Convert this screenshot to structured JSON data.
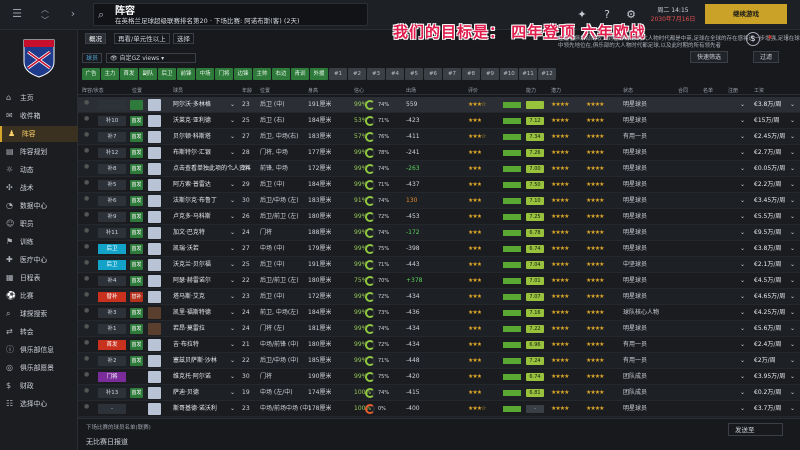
{
  "top": {
    "title": "阵容",
    "subtitle": "在英格兰足球超级联赛排名第20 · 下场比赛: 阿诺布斯(客) (2天)",
    "clock_time": "周二 14:15",
    "clock_date": "2030年7月16日",
    "continue_label": "继续游戏",
    "nav_back": "‹",
    "nav_forward": "›"
  },
  "sidebar": {
    "items": [
      {
        "label": "主页",
        "icon": "home-icon",
        "glyph": "⌂"
      },
      {
        "label": "收件箱",
        "icon": "inbox-icon",
        "glyph": "✉"
      },
      {
        "label": "阵容",
        "icon": "squad-icon",
        "glyph": "♟",
        "active": true
      },
      {
        "label": "阵容规划",
        "icon": "plan-icon",
        "glyph": "▤"
      },
      {
        "label": "动态",
        "icon": "dynamics-icon",
        "glyph": "☼"
      },
      {
        "label": "战术",
        "icon": "tactics-icon",
        "glyph": "✣"
      },
      {
        "label": "数据中心",
        "icon": "data-icon",
        "glyph": "◔"
      },
      {
        "label": "职员",
        "icon": "staff-icon",
        "glyph": "☺"
      },
      {
        "label": "训练",
        "icon": "training-icon",
        "glyph": "⚑"
      },
      {
        "label": "医疗中心",
        "icon": "medical-icon",
        "glyph": "✚"
      },
      {
        "label": "日程表",
        "icon": "calendar-icon",
        "glyph": "▦"
      },
      {
        "label": "比赛",
        "icon": "match-icon",
        "glyph": "⚽"
      },
      {
        "label": "球探搜索",
        "icon": "scout-icon",
        "glyph": "⌕"
      },
      {
        "label": "转会",
        "icon": "transfer-icon",
        "glyph": "⇄"
      },
      {
        "label": "俱乐部信息",
        "icon": "club-info-icon",
        "glyph": "ⓘ"
      },
      {
        "label": "俱乐部愿景",
        "icon": "vision-icon",
        "glyph": "◎"
      },
      {
        "label": "财政",
        "icon": "finance-icon",
        "glyph": "$"
      },
      {
        "label": "选择中心",
        "icon": "dev-icon",
        "glyph": "☷"
      }
    ]
  },
  "tabs": [
    "概况",
    "再看/单元性以上",
    "选择"
  ],
  "slogan": "我们的目标是： 四年登顶 六年欧战",
  "overlay_text": "在这位俱乐部的收入到位,俱乐部的大人物时代都是中英,足球在全球的存在感将进一步增强,足球在球员之中领先地位在,俱乐部的大人物时代都足球,以及此时期的所有领先者",
  "view": {
    "label": "自定GZ views",
    "filter_label": "球员"
  },
  "right_dropdowns": [
    "快速筛选",
    "过滤"
  ],
  "chips": [
    "广告",
    "主力",
    "首发",
    "副队",
    "后卫",
    "前锋",
    "中场",
    "门将",
    "边锋",
    "主帅",
    "右边",
    "青训",
    "外援",
    "#1",
    "#2",
    "#3",
    "#4",
    "#5",
    "#6",
    "#7",
    "#8",
    "#9",
    "#10",
    "#11",
    "#12"
  ],
  "headers": [
    "阵容/状态",
    "位置",
    "球员",
    "年龄",
    "位置",
    "身高",
    "体重",
    "信心",
    "出场",
    "评价",
    "能力",
    "潜力",
    "状态",
    "合同",
    "名单",
    "注册",
    "时间",
    "工资"
  ],
  "players": [
    {
      "status": "",
      "role": "",
      "name": "阿尔沃·多林格",
      "age": "23",
      "pos": "后卫 (中)",
      "height": "191厘米",
      "pct": "99%",
      "ring": "74%",
      "cash": "559",
      "cashc": "",
      "stars": "★★★☆",
      "ab": "",
      "stars2": "★★★★",
      "stars3": "★★★★",
      "tag": "明星球员",
      "wage": "€3.8万/周",
      "face": "l",
      "hl": true
    },
    {
      "status": "补10",
      "role": "首发",
      "rolec": "g",
      "name": "沃莱克·亚利德",
      "age": "25",
      "pos": "后卫 (右)",
      "height": "184厘米",
      "pct": "53%",
      "ring": "71%",
      "cash": "-423",
      "cashc": "",
      "stars": "★★★",
      "ab": "7.12",
      "stars2": "★★★★",
      "stars3": "★★★★",
      "tag": "明星球员",
      "wage": "€15万/周",
      "face": "l"
    },
    {
      "status": "补7",
      "role": "首发",
      "rolec": "g",
      "name": "贝尔顿·科斯塔",
      "age": "27",
      "pos": "后卫, 中场(右)",
      "height": "183厘米",
      "pct": "57%",
      "ring": "76%",
      "cash": "-411",
      "cashc": "",
      "stars": "★★★☆",
      "ab": "7.34",
      "stars2": "★★★★",
      "stars3": "★★★★",
      "tag": "有用一员",
      "wage": "€2.45万/周",
      "face": "l"
    },
    {
      "status": "补12",
      "role": "首发",
      "rolec": "g",
      "name": "布斯特尔·汇银",
      "age": "28",
      "pos": "门将, 中场",
      "height": "177厘米",
      "pct": "99%",
      "ring": "78%",
      "cash": "-241",
      "cashc": "",
      "stars": "★★★",
      "ab": "7.26",
      "stars2": "★★★★",
      "stars3": "★★★★",
      "tag": "明星球员",
      "wage": "€2.7万/周",
      "face": "l"
    },
    {
      "status": "补8",
      "role": "首发",
      "rolec": "g",
      "name": "点击查看单独此项的个人资料",
      "age": "24",
      "pos": "前锋, 中场",
      "height": "172厘米",
      "pct": "99%",
      "ring": "74%",
      "cash": "-263",
      "cashc": "green",
      "stars": "★★★",
      "ab": "7.00",
      "stars2": "★★★★",
      "stars3": "★★★★",
      "tag": "明星球员",
      "wage": "€0.05万/周",
      "face": "l"
    },
    {
      "status": "补5",
      "role": "首发",
      "rolec": "g",
      "name": "阿方索·普雷达",
      "age": "29",
      "pos": "后卫 (中)",
      "height": "184厘米",
      "pct": "99%",
      "ring": "71%",
      "cash": "-437",
      "cashc": "",
      "stars": "★★★",
      "ab": "7.50",
      "stars2": "★★★★",
      "stars3": "★★★★",
      "tag": "明星球员",
      "wage": "€2.2万/周",
      "face": "l"
    },
    {
      "status": "补6",
      "role": "首发",
      "rolec": "g",
      "name": "法斯尔克·布鲁丁",
      "age": "30",
      "pos": "后卫/中场 (左)",
      "height": "183厘米",
      "pct": "91%",
      "ring": "74%",
      "cash": "130",
      "cashc": "orange",
      "stars": "★★★",
      "ab": "7.10",
      "stars2": "★★★★",
      "stars3": "★★★★",
      "tag": "明星球员",
      "wage": "€3.45万/周",
      "face": "l"
    },
    {
      "status": "补9",
      "role": "首发",
      "rolec": "g",
      "name": "卢克多·马科斯",
      "age": "26",
      "pos": "后卫/前卫 (左)",
      "height": "180厘米",
      "pct": "99%",
      "ring": "72%",
      "cash": "-453",
      "cashc": "",
      "stars": "★★★",
      "ab": "7.25",
      "stars2": "★★★★",
      "stars3": "★★★★",
      "tag": "明星球员",
      "wage": "€5.5万/周",
      "face": "l"
    },
    {
      "status": "补11",
      "role": "首发",
      "rolec": "g",
      "name": "加文·巴克特",
      "age": "24",
      "pos": "门将",
      "height": "188厘米",
      "pct": "99%",
      "ring": "74%",
      "cash": "-172",
      "cashc": "green",
      "stars": "★★★",
      "ab": "6.78",
      "stars2": "★★★★",
      "stars3": "★★★★",
      "tag": "明星球员",
      "wage": "€9.5万/周",
      "face": "l"
    },
    {
      "status": "后卫",
      "statusc": "cyan",
      "role": "首发",
      "rolec": "g",
      "name": "凯瑞·沃若",
      "age": "27",
      "pos": "中场 (中)",
      "height": "179厘米",
      "pct": "99%",
      "ring": "75%",
      "cash": "-398",
      "cashc": "",
      "stars": "★★★",
      "ab": "6.74",
      "stars2": "★★★★",
      "stars3": "★★★★",
      "tag": "明星球员",
      "wage": "€3.8万/周",
      "face": "l"
    },
    {
      "status": "后卫",
      "statusc": "cyan",
      "role": "首发",
      "rolec": "g",
      "name": "沃克兰·贝尔福",
      "age": "25",
      "pos": "后卫 (中)",
      "height": "191厘米",
      "pct": "99%",
      "ring": "71%",
      "cash": "-443",
      "cashc": "",
      "stars": "★★★",
      "ab": "7.04",
      "stars2": "★★★★",
      "stars3": "★★★★",
      "tag": "中坚球员",
      "wage": "€2.1万/周",
      "face": "l"
    },
    {
      "status": "补4",
      "role": "首发",
      "rolec": "g",
      "name": "阿瑟·赫雷诺尔",
      "age": "22",
      "pos": "后卫/前卫 (左)",
      "height": "180厘米",
      "pct": "75%",
      "ring": "70%",
      "cash": "+378",
      "cashc": "green",
      "stars": "★★★",
      "ab": "7.01",
      "stars2": "★★★★",
      "stars3": "★★★★",
      "tag": "明星球员",
      "wage": "€4.5万/周",
      "face": "l"
    },
    {
      "status": "替补",
      "statusc": "red",
      "role": "替补",
      "rolec": "r",
      "name": "塔马斯·艾克",
      "age": "23",
      "pos": "后卫 (中)",
      "height": "172厘米",
      "pct": "99%",
      "ring": "72%",
      "cash": "-434",
      "cashc": "",
      "stars": "★★★",
      "ab": "7.07",
      "stars2": "★★★★",
      "stars3": "★★★★",
      "tag": "明星球员",
      "wage": "€4.65万/周",
      "face": "l"
    },
    {
      "status": "补3",
      "role": "首发",
      "rolec": "g",
      "name": "凯里·福斯特德",
      "age": "24",
      "pos": "前卫, 中场(左)",
      "height": "184厘米",
      "pct": "99%",
      "ring": "73%",
      "cash": "-436",
      "cashc": "",
      "stars": "★★★",
      "ab": "7.16",
      "stars2": "★★★★",
      "stars3": "★★★★",
      "tag": "球队核心人物",
      "wage": "€4.25万/周",
      "face": "d"
    },
    {
      "status": "补1",
      "role": "首发",
      "rolec": "g",
      "name": "若昂·莫雷拉",
      "age": "24",
      "pos": "门将 (左)",
      "height": "181厘米",
      "pct": "99%",
      "ring": "74%",
      "cash": "-434",
      "cashc": "",
      "stars": "★★★",
      "ab": "7.22",
      "stars2": "★★★★",
      "stars3": "★★★★",
      "tag": "明星球员",
      "wage": "€5.6万/周",
      "face": "d"
    },
    {
      "status": "首发",
      "statusc": "red",
      "role": "首发",
      "rolec": "g",
      "name": "吉·布拉特",
      "age": "21",
      "pos": "中场/前锋 (中)",
      "height": "180厘米",
      "pct": "99%",
      "ring": "72%",
      "cash": "-434",
      "cashc": "",
      "stars": "★★★",
      "ab": "6.96",
      "stars2": "★★★★",
      "stars3": "★★★★",
      "tag": "有用一员",
      "wage": "€2.4万/周",
      "face": "l"
    },
    {
      "status": "补2",
      "role": "首发",
      "rolec": "g",
      "name": "塞兹贝萨斯·沙林",
      "age": "22",
      "pos": "后卫/中场 (中)",
      "height": "185厘米",
      "pct": "99%",
      "ring": "71%",
      "cash": "-448",
      "cashc": "",
      "stars": "★★★",
      "ab": "7.24",
      "stars2": "★★★★",
      "stars3": "★★★★",
      "tag": "有用一员",
      "wage": "€2万/周",
      "face": "l"
    },
    {
      "status": "门将",
      "statusc": "purple",
      "role": "",
      "rolec": "n",
      "name": "维克托·阿尔诺",
      "age": "30",
      "pos": "门将",
      "height": "190厘米",
      "pct": "99%",
      "ring": "75%",
      "cash": "-420",
      "cashc": "",
      "stars": "★★★",
      "ab": "6.74",
      "stars2": "★★★★",
      "stars3": "★★★★",
      "tag": "团队成员",
      "wage": "€3.95万/周",
      "face": "l"
    },
    {
      "status": "补13",
      "role": "首发",
      "rolec": "g",
      "name": "萨迪·贝德",
      "age": "19",
      "pos": "中场 (左/中)",
      "height": "174厘米",
      "pct": "100%",
      "ring": "74%",
      "cash": "-415",
      "cashc": "",
      "stars": "★★★",
      "ab": "6.81",
      "stars2": "★★★★",
      "stars3": "★★★★",
      "tag": "团队成员",
      "wage": "€0.2万/周",
      "face": "l"
    },
    {
      "status": "-",
      "role": "",
      "rolec": "n",
      "name": "斯哥基德·诺沃利",
      "age": "23",
      "pos": "中场/前场中场 (中)",
      "height": "178厘米",
      "pct": "100%",
      "ring": "0%",
      "ringc": "warn",
      "cash": "-400",
      "cashc": "",
      "stars": "★★★☆",
      "ab": "-",
      "abc": "grey",
      "stars2": "★★★★",
      "stars3": "★★★★",
      "tag": "明星球员",
      "wage": "€3.7万/周",
      "face": "l"
    },
    {
      "status": "后卫",
      "statusc": "cyan",
      "role": "首发",
      "rolec": "g",
      "name": "阿马罗·桑德",
      "age": "23",
      "pos": "后卫 (中)",
      "height": "185厘米",
      "pct": "99%",
      "ring": "73%",
      "cash": "-431",
      "cashc": "",
      "stars": "★★★",
      "ab": "6.94",
      "stars2": "★★★★",
      "stars3": "★★★★",
      "tag": "明星球员",
      "wage": "€5.5万/周",
      "face": "l"
    }
  ],
  "footer": {
    "line1": "下场比赛的球员名单(联赛)",
    "line2": "无比赛日报道",
    "dropdown": "发送至"
  }
}
